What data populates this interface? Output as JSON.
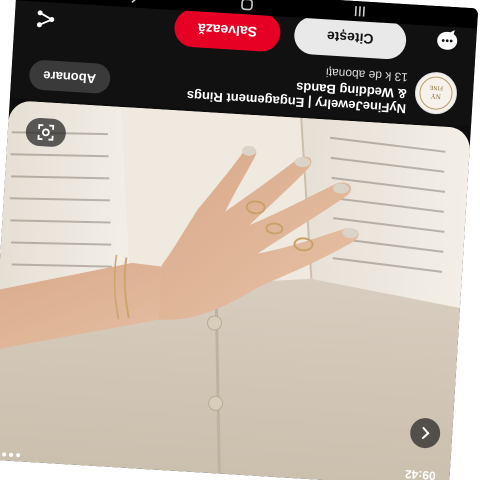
{
  "status_bar": {
    "time": "09:42"
  },
  "pin": {
    "board_name": "NyFineJewelry | Engagement Rings & Wedding Bands",
    "followers": "13 k de abonați",
    "follow_label": "Abonare",
    "read_label": "Citește",
    "save_label": "Salvează",
    "avatar_text": "NY FINE"
  },
  "icons": {
    "close": "chevron-left-icon",
    "lens": "visual-search-icon",
    "share": "share-icon",
    "comment": "comment-icon",
    "nav_back": "nav-back-icon",
    "nav_home": "nav-home-icon",
    "nav_recents": "nav-recents-icon"
  },
  "colors": {
    "save_button": "#e60023",
    "panel": "#111111",
    "read_button": "#e9e9e9"
  }
}
